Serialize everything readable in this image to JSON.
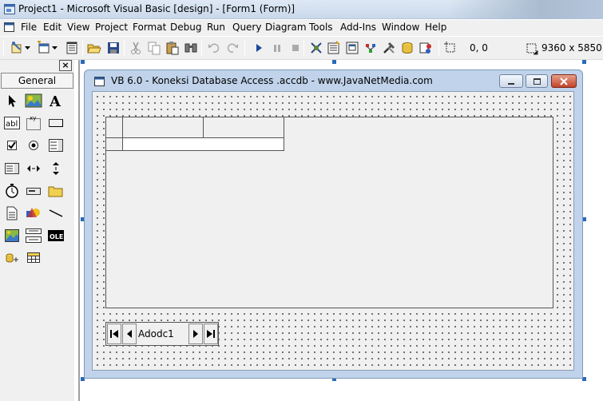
{
  "window": {
    "title": "Project1 - Microsoft Visual Basic [design] - [Form1 (Form)]"
  },
  "menu": {
    "items": [
      {
        "label": "File"
      },
      {
        "label": "Edit"
      },
      {
        "label": "View"
      },
      {
        "label": "Project"
      },
      {
        "label": "Format"
      },
      {
        "label": "Debug"
      },
      {
        "label": "Run"
      },
      {
        "label": "Query"
      },
      {
        "label": "Diagram"
      },
      {
        "label": "Tools"
      },
      {
        "label": "Add-Ins"
      },
      {
        "label": "Window"
      },
      {
        "label": "Help"
      }
    ]
  },
  "toolbar": {
    "position": "0, 0",
    "size": "9360 x 5850"
  },
  "toolbox": {
    "tab_label": "General",
    "close_label": "×"
  },
  "form": {
    "title": "VB 6.0 - Koneksi Database Access .accdb - www.JavaNetMedia.com",
    "adodc_caption": "Adodc1"
  }
}
